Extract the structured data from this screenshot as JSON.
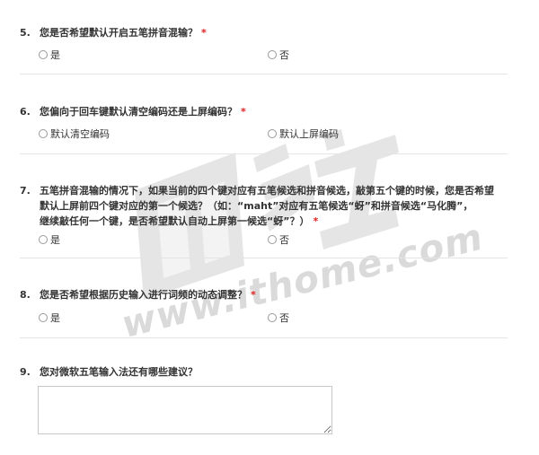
{
  "questions": [
    {
      "number": "5.",
      "text": "您是否希望默认开启五笔拼音混输？",
      "required": "*",
      "options": [
        "是",
        "否"
      ]
    },
    {
      "number": "6.",
      "text": "您偏向于回车键默认清空编码还是上屏编码？",
      "required": "*",
      "options": [
        "默认清空编码",
        "默认上屏编码"
      ]
    },
    {
      "number": "7.",
      "text_lines": [
        "五笔拼音混输的情况下，如果当前的四个键对应有五笔候选和拼音候选，敲第五个键的时候，您是否希望",
        "默认上屏前四个键对应的第一个候选？（如：“maht”对应有五笔候选“蚜”和拼音候选“马化腾”，",
        "继续敲任何一个键，是否希望默认自动上屏第一候选“蚜”？）"
      ],
      "required": "*",
      "options": [
        "是",
        "否"
      ]
    },
    {
      "number": "8.",
      "text": "您是否希望根据历史输入进行词频的动态调整？",
      "required": "*",
      "options": [
        "是",
        "否"
      ]
    },
    {
      "number": "9.",
      "text": "您对微软五笔输入法还有哪些建议？",
      "answer_value": ""
    }
  ],
  "watermark": {
    "text": "www.ithome.com",
    "color": "#969696"
  },
  "colors": {
    "required": "#e02020",
    "text": "#333333",
    "divider": "#e4e4e4"
  }
}
